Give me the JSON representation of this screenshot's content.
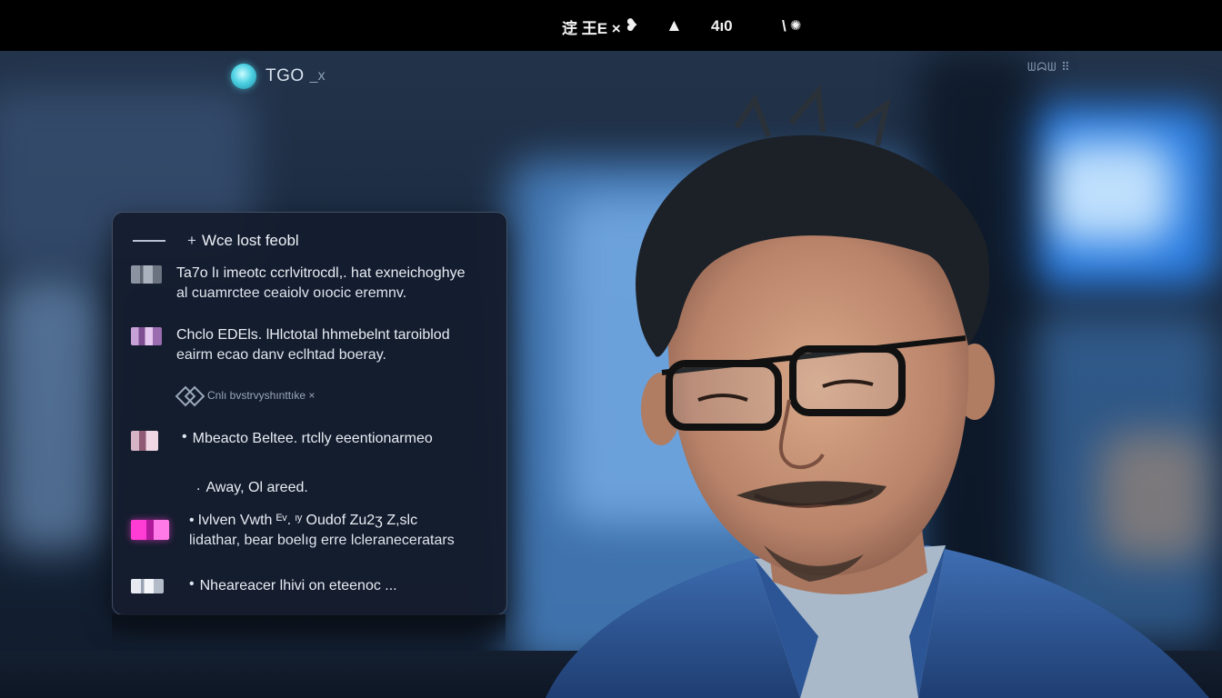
{
  "topbar": {
    "items": [
      {
        "label": "䢓 王E ×",
        "icon": "chat-bubble-icon"
      },
      {
        "label": "",
        "icon": "triangle-icon"
      },
      {
        "label": "4ı0",
        "icon": ""
      },
      {
        "label": "\\",
        "icon": "gear-icon"
      }
    ]
  },
  "app": {
    "name": "TGO",
    "close": "_x"
  },
  "panel": {
    "header_title": "Wce lost feobl",
    "messages": [
      {
        "line1": "Ta7o lı imeotc ccrlvitrocdl,. hat exneichoghye",
        "line2": "al cuamrctee ceaiolv oıocic eremnv.",
        "thumb": "grey"
      },
      {
        "line1": "Chclo EDEls. lHlctotal hhmebelnt taroiblod",
        "line2": "eairm ecao danv eclhtad boeray.",
        "thumb": "purple"
      },
      {
        "line1": "Mbeacto Beltee.  rtclly eeentionarmeo",
        "line2": "",
        "thumb": "mauve"
      },
      {
        "line1": "Away, Ol areed.",
        "line2": "",
        "thumb": ""
      },
      {
        "line1": "Ivlven Vwth ᴱᵛ. ᶦʸ Oudof Zu2ʒ Z,slc",
        "line2": "lidathar, bear boelıg erre lcleraneceratars",
        "thumb": "magenta"
      },
      {
        "line1": "Nheareacer lhivi on eteenoc ...",
        "line2": "",
        "thumb": "light"
      }
    ],
    "sub_label": "Cnlı bvstrvyshınttıke ×"
  },
  "topright": "ᗯᗣᗯ ⠿"
}
